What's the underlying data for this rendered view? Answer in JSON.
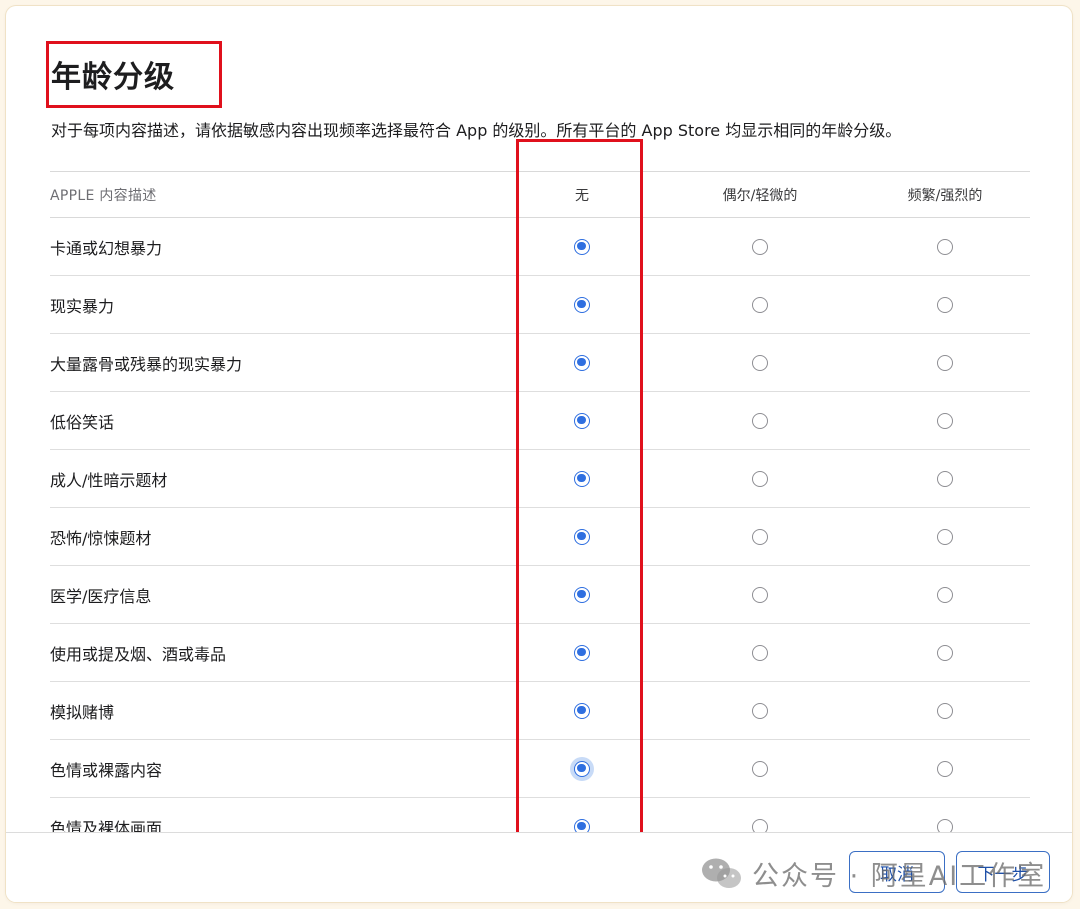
{
  "page": {
    "title": "年龄分级",
    "description": "对于每项内容描述，请依据敏感内容出现频率选择最符合 App 的级别。所有平台的 App Store 均显示相同的年龄分级。"
  },
  "table": {
    "headers": {
      "label": "APPLE 内容描述",
      "none": "无",
      "occasional": "偶尔/轻微的",
      "frequent": "频繁/强烈的"
    },
    "rows": [
      {
        "label": "卡通或幻想暴力",
        "selected": "none"
      },
      {
        "label": "现实暴力",
        "selected": "none"
      },
      {
        "label": "大量露骨或残暴的现实暴力",
        "selected": "none"
      },
      {
        "label": "低俗笑话",
        "selected": "none"
      },
      {
        "label": "成人/性暗示题材",
        "selected": "none"
      },
      {
        "label": "恐怖/惊悚题材",
        "selected": "none"
      },
      {
        "label": "医学/医疗信息",
        "selected": "none"
      },
      {
        "label": "使用或提及烟、酒或毒品",
        "selected": "none"
      },
      {
        "label": "模拟赌博",
        "selected": "none"
      },
      {
        "label": "色情或裸露内容",
        "selected": "none",
        "focused": true
      },
      {
        "label": "色情及裸体画面",
        "selected": "none"
      }
    ]
  },
  "footer": {
    "cancel_label": "取消",
    "next_label": "下一步"
  },
  "watermark": {
    "text": "公众号 · 阿星AI工作室",
    "icon": "wechat-icon"
  },
  "colors": {
    "accent": "#2f6fe0",
    "highlight_box": "#e0101c"
  }
}
